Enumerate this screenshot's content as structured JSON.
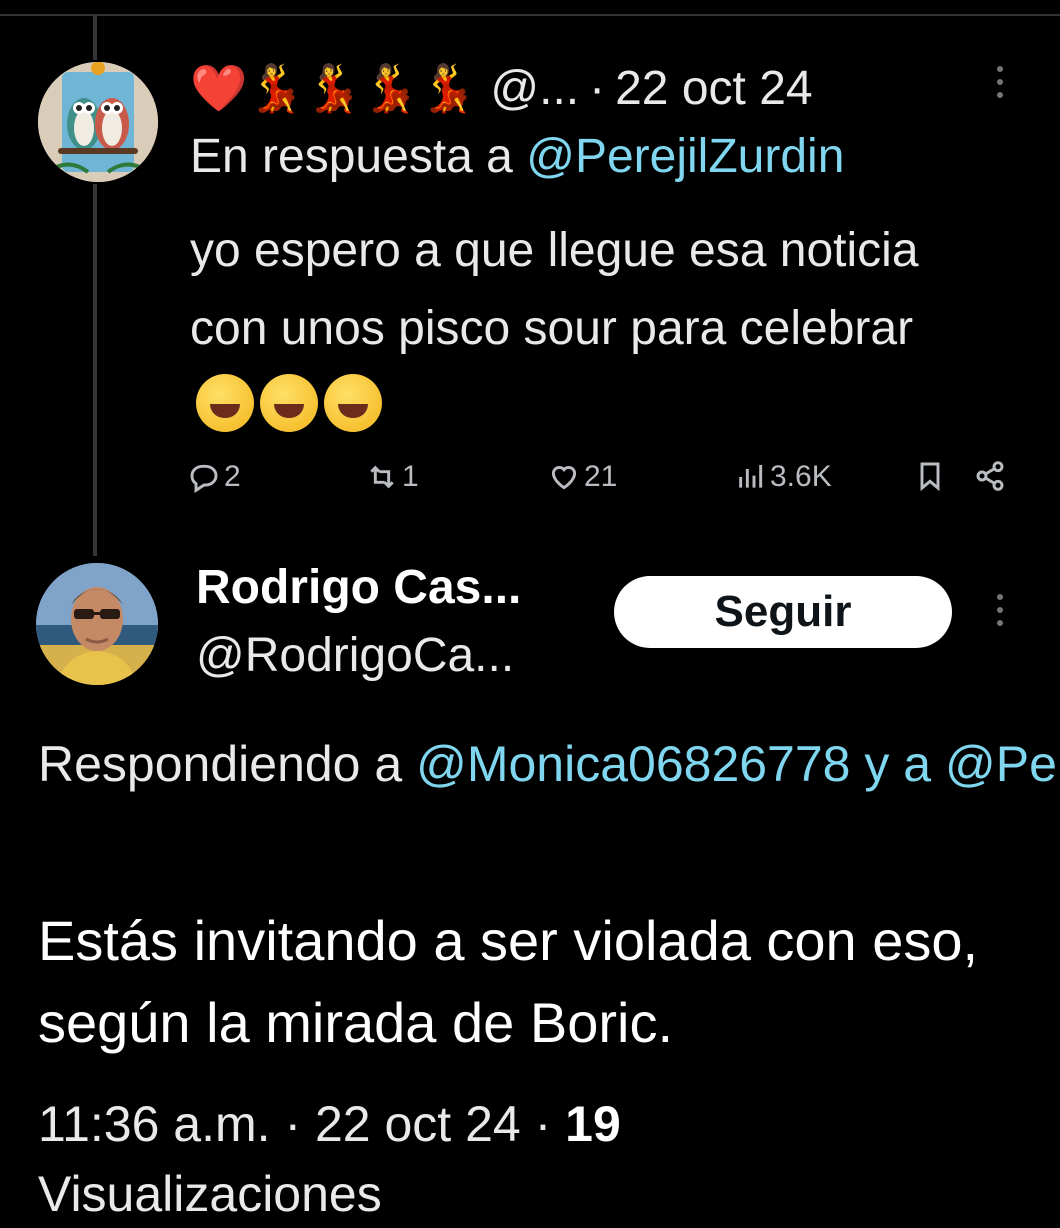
{
  "tweet1": {
    "display_name_emojis": "❤️💃💃💃💃",
    "handle": "@...",
    "separator": "·",
    "date": "22 oct 24",
    "reply_prefix": "En respuesta a ",
    "reply_mention": "@PerejilZurdin",
    "text": "yo espero a que llegue esa noticia con unos pisco sour para celebrar",
    "emoji_suffix_icon": "grinning-squinting-face-icon",
    "actions": {
      "replies": "2",
      "reposts": "1",
      "likes": "21",
      "views": "3.6K"
    }
  },
  "tweet2": {
    "display_name": "Rodrigo Cas...",
    "handle": "@RodrigoCa...",
    "follow_label": "Seguir",
    "reply_prefix": "Respondiendo a ",
    "reply_mention1": "@Monica06826778",
    "reply_connector": " y a ",
    "reply_mention2": "@PerejilZurdin",
    "text": "Estás invitando a ser violada con eso, según la mirada de Boric.",
    "time": "11:36 a.m.",
    "separator": " · ",
    "date": "22 oct 24",
    "separator2": " · ",
    "views_count": "19",
    "views_label": "Visualizaciones"
  },
  "colors": {
    "background": "#000000",
    "text": "#e7e9ea",
    "mention": "#7fd6ee",
    "muted": "#71767b",
    "button_bg": "#ffffff"
  }
}
